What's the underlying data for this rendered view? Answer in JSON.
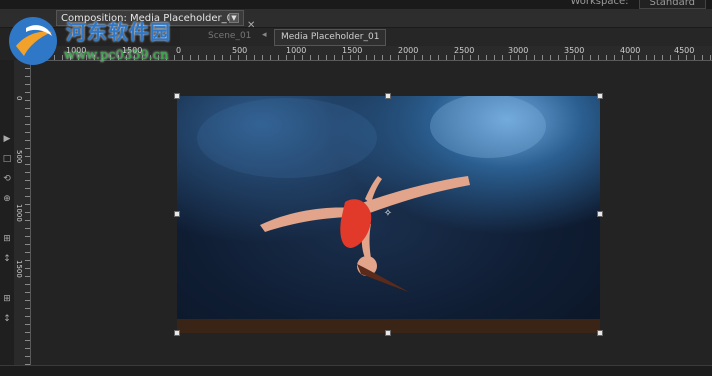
{
  "topbar": {
    "workspace_label": "Workspace:",
    "workspace_value": "Standard"
  },
  "tab": {
    "title": "Composition: Media Placeholder_01",
    "menu_glyph": "▼",
    "close_glyph": "✕"
  },
  "scene": {
    "label": "Scene_01",
    "arrow": "◂",
    "chip": "Media Placeholder_01"
  },
  "ruler": {
    "h_numbers": [
      "1000",
      "1500",
      "0",
      "500",
      "1000",
      "1500",
      "2000",
      "2500",
      "3000",
      "3500",
      "4000",
      "4500"
    ],
    "v_numbers": [
      "0",
      "500",
      "1000",
      "1500"
    ]
  },
  "tools": [
    "▶",
    "□",
    "⟲",
    "⊕",
    "⊞",
    "↕",
    "⊞",
    "↕"
  ],
  "crosshair": "✧",
  "watermark": {
    "title": "河东软件园",
    "url": "www.pc0359.cn"
  }
}
